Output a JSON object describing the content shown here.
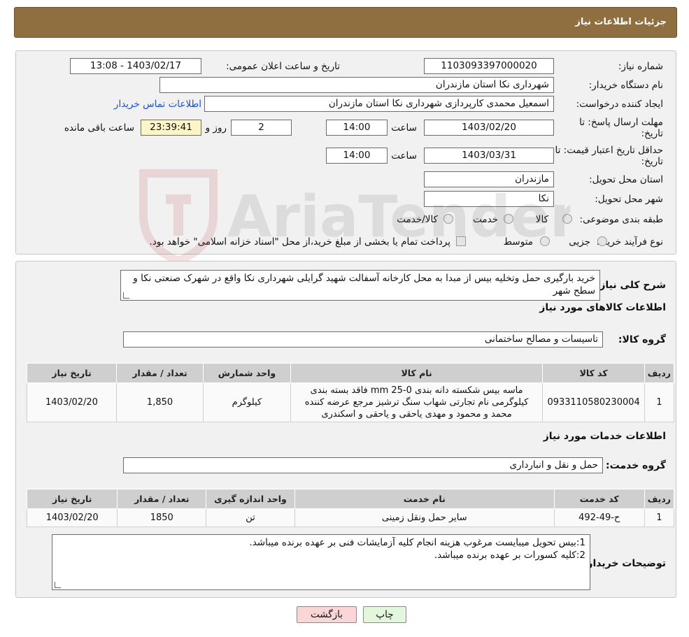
{
  "header": {
    "title": "جزئیات اطلاعات نیاز"
  },
  "form": {
    "need_number_label": "شماره نیاز:",
    "need_number": "1103093397000020",
    "announce_label": "تاریخ و ساعت اعلان عمومی:",
    "announce_value": "1403/02/17 - 13:08",
    "buyer_org_label": "نام دستگاه خریدار:",
    "buyer_org": "شهرداری نکا استان مازندران",
    "creator_label": "ایجاد کننده درخواست:",
    "creator": "اسمعیل محمدی کارپردازی شهرداری نکا استان مازندران",
    "contact_link": "اطلاعات تماس خریدار",
    "deadline_label_1": "مهلت ارسال پاسخ: تا",
    "deadline_label_2": "تاریخ:",
    "deadline_date": "1403/02/20",
    "time_label": "ساعت",
    "deadline_time": "14:00",
    "days_value": "2",
    "days_label": "روز و",
    "remaining_time": "23:39:41",
    "remaining_label": "ساعت باقی مانده",
    "validity_label_1": "حداقل تاریخ اعتبار قیمت: تا",
    "validity_label_2": "تاریخ:",
    "validity_date": "1403/03/31",
    "validity_time": "14:00",
    "province_label": "استان محل تحویل:",
    "province": "مازندران",
    "city_label": "شهر محل تحویل:",
    "city": "نکا",
    "category_label": "طبقه بندی موضوعی:",
    "category_options": [
      "کالا",
      "خدمت",
      "کالا/خدمت"
    ],
    "process_label": "نوع فرآیند خرید :",
    "process_options": [
      "جزیی",
      "متوسط"
    ],
    "process_note": "پرداخت تمام یا بخشی از مبلغ خرید،از محل \"اسناد خزانه اسلامی\" خواهد بود."
  },
  "description": {
    "label": "شرح کلی نیاز:",
    "text": "خرید بارگیری حمل وتخلیه بیس از مبدا به محل کارخانه آسفالت شهید گرایلی شهرداری نکا واقع در شهرک صنعتی نکا و سطح شهر"
  },
  "goods": {
    "section_title": "اطلاعات کالاهای مورد نیاز",
    "group_label": "گروه کالا:",
    "group_value": "تاسیسات و مصالح ساختمانی",
    "headers": [
      "ردیف",
      "کد کالا",
      "نام کالا",
      "واحد شمارش",
      "تعداد / مقدار",
      "تاریخ نیاز"
    ],
    "rows": [
      {
        "row": "1",
        "code": "0933110580230004",
        "name": "ماسه بیس شکسته دانه بندی mm 25-0 فاقد بسته بندی کیلوگرمی نام تجارتی شهاب سنگ ترشیز مرجع عرضه کننده محمد و محمود و مهدی یاحقی و یاحقی و اسکندری",
        "unit": "کیلوگرم",
        "qty": "1,850",
        "date": "1403/02/20"
      }
    ]
  },
  "services": {
    "section_title": "اطلاعات خدمات مورد نیاز",
    "group_label": "گروه خدمت:",
    "group_value": "حمل و نقل و انبارداری",
    "headers": [
      "ردیف",
      "کد خدمت",
      "نام خدمت",
      "واحد اندازه گیری",
      "تعداد / مقدار",
      "تاریخ نیاز"
    ],
    "rows": [
      {
        "row": "1",
        "code": "ح-49-492",
        "name": "سایر حمل ونقل زمینی",
        "unit": "تن",
        "qty": "1850",
        "date": "1403/02/20"
      }
    ]
  },
  "buyer_notes": {
    "label": "توضیحات خریدار:",
    "line1": "1:بیس تحویل میبایست مرغوب هزینه انجام کلیه آزمایشات فنی بر عهده برنده میباشد.",
    "line2": "2:کلیه کسورات بر عهده برنده میباشد."
  },
  "buttons": {
    "print": "چاپ",
    "back": "بازگشت"
  },
  "watermark": {
    "text": "AriaTender.neT"
  },
  "colors": {
    "header_bg": "#8f6f40",
    "panel_bg": "#f1f1f1",
    "link": "#1a4fd6",
    "back_btn": "#fbd6d6",
    "print_btn": "#e3f7dc"
  }
}
